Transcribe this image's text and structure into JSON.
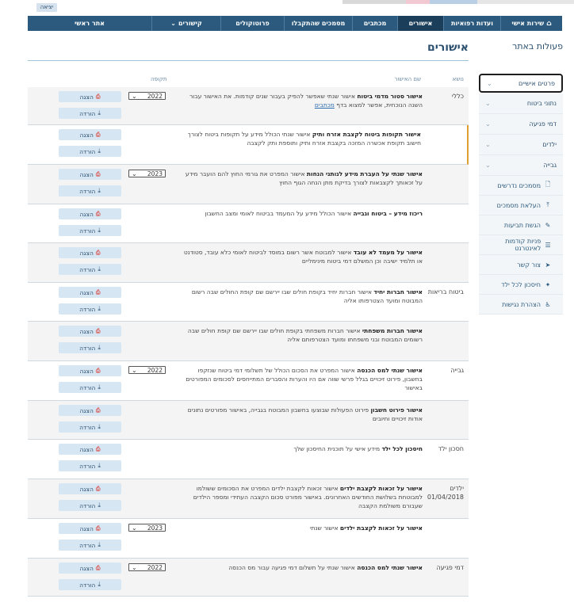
{
  "topbar": {
    "exit_label": "יציאה"
  },
  "nav": [
    {
      "label": "שירות אישי",
      "home_icon": "home-icon",
      "active": false
    },
    {
      "label": "ועדות רפואיות",
      "active": false
    },
    {
      "label": "אישורים",
      "active": true
    },
    {
      "label": "מכתבים",
      "active": false
    },
    {
      "label": "מסמכים שהתקבלו",
      "active": false
    },
    {
      "label": "פרוטוקולים",
      "active": false
    },
    {
      "label": "קישורים",
      "dropdown": true,
      "active": false
    },
    {
      "label": "אתר ראשי",
      "active": false
    }
  ],
  "sidebar": {
    "title": "פעולות באתר",
    "accordions": [
      {
        "label": "פרטים אישיים",
        "icon": "chevron-down-icon"
      },
      {
        "label": "נתוני ביטוח",
        "icon": "chevron-down-icon"
      },
      {
        "label": "דמי פגיעה",
        "icon": "chevron-down-icon"
      },
      {
        "label": "ילדים",
        "icon": "chevron-down-icon"
      },
      {
        "label": "גבייה",
        "icon": "chevron-down-icon"
      }
    ],
    "links": [
      {
        "label": "מסמכים נדרשים",
        "icon": "document-icon"
      },
      {
        "label": "העלאת מסמכים",
        "icon": "upload-icon"
      },
      {
        "label": "הגשת תביעות",
        "icon": "edit-icon"
      },
      {
        "label": "פניות קודמות לאינטרנט",
        "icon": "list-icon"
      },
      {
        "label": "צור קשר",
        "icon": "send-icon"
      },
      {
        "label": "חיסכון לכל ילד",
        "icon": "child-icon"
      },
      {
        "label": "הצהרת נגישות",
        "icon": "accessibility-icon"
      }
    ]
  },
  "main": {
    "title": "אישורים",
    "columns": {
      "topic": "נושא",
      "name": "שם האישור",
      "period": "תקופה"
    },
    "buttons": {
      "view": "הצגה",
      "download": "הורדה"
    },
    "rows": [
      {
        "topic": "כללי",
        "bold": "אישור סטור מדמי ביטוח",
        "text": " אישור שנתי שאפשר להפיק בעבור שנים קודמות. את האישור עבור השנה הנוכחית, אפשר למצוא בדף ",
        "link": "מכתבים",
        "period": "2022"
      },
      {
        "topic": "",
        "bold": "אישור תקופות ביטוח לקצבת אזרח ותיק",
        "text": " אישור שנתי הכולל מידע על תקופות ביטוח לצורך חישוב תקופת אכשרה המזכה בקצבת אזרח ותיק ותוספת ותק לקצבה",
        "link": "",
        "period": ""
      },
      {
        "topic": "",
        "bold": "אישור שנתי על העברת מידע לנותני הנחות",
        "text": " אישור המפרט את גורמי החוץ להם הועבר מידע על זכאותך לקצבאות לצורך בדיקת מתן הנחה הגוף החוץ",
        "link": "",
        "period": "2023"
      },
      {
        "topic": "",
        "bold": "ריכוז מידע – ביטוח וגבייה",
        "text": " אישור הכולל מידע על המעמד בביטוח לאומי ומצב החשבון",
        "link": "",
        "period": ""
      },
      {
        "topic": "",
        "bold": "אישור על מעמד לא עובד",
        "text": " אישור למבוטח אשר רשום במוסד לביטוח לאומי כלא עובד, סטודנט או תלמיד ישיבה וכן המשלם דמי ביטוח מינימליים",
        "link": "",
        "period": ""
      },
      {
        "topic": "ביטוח בריאות",
        "bold": "אישור חברות יחיד",
        "text": " אישור חברות יחיד בקופת חולים שבו יירשם שם קופת החולים שבה רשום המבוטח ומועד הצטרפותו אליה",
        "link": "",
        "period": ""
      },
      {
        "topic": "",
        "bold": "אישור חברות משפחתי",
        "text": " אישור חברות משפחתי בקופת חולים שבו יירשם שם קופת חולים שבה רשומים המבוטח ובני משפחתו ומועד הצטרפותם אליה",
        "link": "",
        "period": ""
      },
      {
        "topic": "גבייה",
        "bold": "אישור שנתי למס הכנסה",
        "text": " אישור המפרט את הסכום הכולל של תשלומי דמי ביטוח שנזקפו בחשבון, פירוט זיכויים בגלל פרשי שווה אם היו והערות והסברים המתייחסים לסכומים המפורטים באישור",
        "link": "",
        "period": "2022"
      },
      {
        "topic": "",
        "bold": "אישור פירוט חשבון",
        "text": " פירוט הפעולות שבוצעו בחשבון המבוטח בגבייה, באישור מפורטים נתונים אודות זיכויים וחיובים",
        "link": "",
        "period": ""
      },
      {
        "topic": "חסכון ילד",
        "bold": "חיסכון לכל ילד",
        "text": " מידע אישי על תוכנית החיסכון שלך",
        "link": "",
        "period": ""
      },
      {
        "topic": "ילדים 01/04/2018",
        "bold": "אישור על זכאות לקצבת ילדים",
        "text": " אישור זכאות לקצבת ילדים המפרט את הסכומים ששולמו למבוטחת בשלושת החודשים האחרונים. באישור מפורט סכום הקצבה העתידי ומספר הילדים שעבורם משולמת הקצבה",
        "link": "",
        "period": ""
      },
      {
        "topic": "",
        "bold": "אישור על זכאות לקצבת ילדים",
        "text": " אישור שנתי",
        "link": "",
        "period": "2023"
      },
      {
        "topic": "דמי פגיעה",
        "bold": "אישור שנתי למס הכנסה",
        "text": " אישור שנתי על תשלום דמי פגיעה עבור מס הכנסה",
        "link": "",
        "period": "2022"
      }
    ]
  }
}
